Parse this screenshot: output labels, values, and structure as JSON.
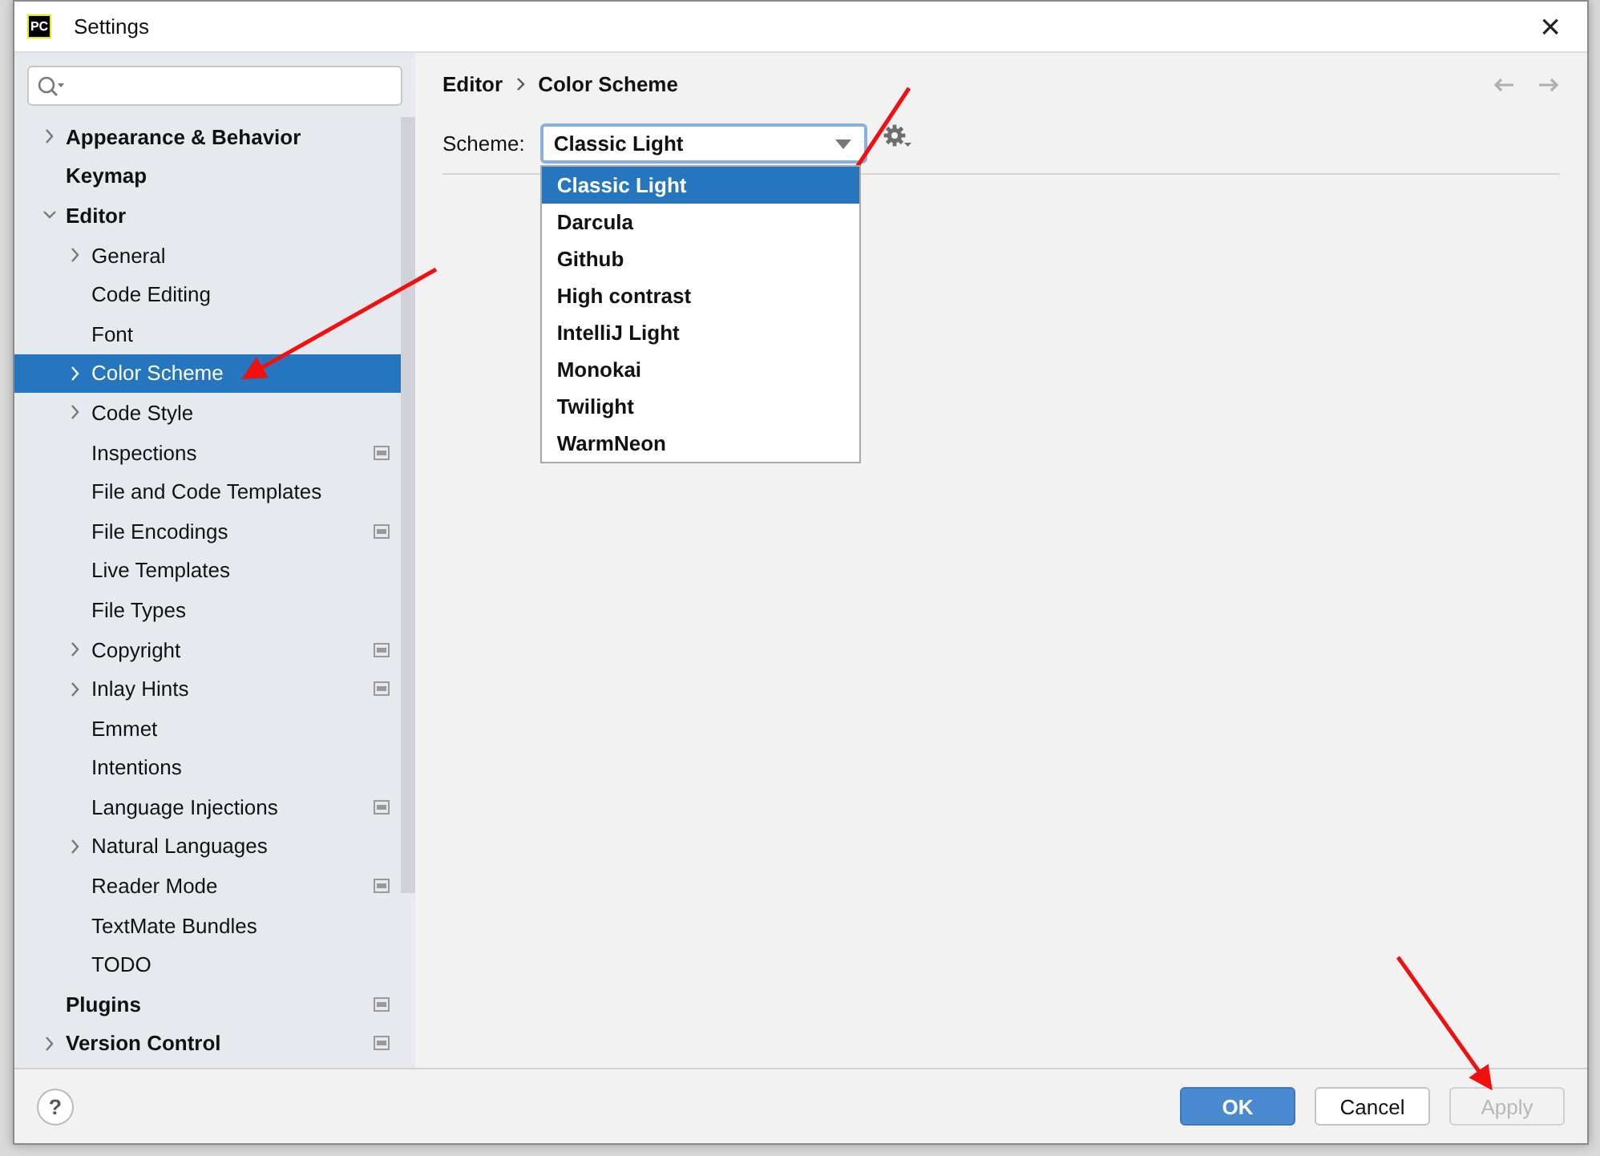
{
  "window": {
    "title": "Settings",
    "logo": "PC",
    "close": "×"
  },
  "sidebar": {
    "items": [
      {
        "label": "Appearance & Behavior",
        "expandable": true,
        "expanded": false,
        "selected": false
      },
      {
        "label": "Keymap",
        "selected": false
      },
      {
        "label": "Editor",
        "expandable": true,
        "expanded": true,
        "selected": false,
        "children": [
          {
            "label": "General",
            "expandable": true,
            "expanded": false,
            "selected": false
          },
          {
            "label": "Code Editing",
            "selected": false
          },
          {
            "label": "Font",
            "selected": false
          },
          {
            "label": "Color Scheme",
            "expandable": true,
            "expanded": false,
            "selected": true
          },
          {
            "label": "Code Style",
            "expandable": true,
            "expanded": false,
            "selected": false
          },
          {
            "label": "Inspections",
            "selected": false,
            "badge": true
          },
          {
            "label": "File and Code Templates",
            "selected": false
          },
          {
            "label": "File Encodings",
            "selected": false,
            "badge": true
          },
          {
            "label": "Live Templates",
            "selected": false
          },
          {
            "label": "File Types",
            "selected": false
          },
          {
            "label": "Copyright",
            "expandable": true,
            "expanded": false,
            "selected": false,
            "badge": true
          },
          {
            "label": "Inlay Hints",
            "expandable": true,
            "expanded": false,
            "selected": false,
            "badge": true
          },
          {
            "label": "Emmet",
            "selected": false
          },
          {
            "label": "Intentions",
            "selected": false
          },
          {
            "label": "Language Injections",
            "selected": false,
            "badge": true
          },
          {
            "label": "Natural Languages",
            "expandable": true,
            "expanded": false,
            "selected": false
          },
          {
            "label": "Reader Mode",
            "selected": false,
            "badge": true
          },
          {
            "label": "TextMate Bundles",
            "selected": false
          },
          {
            "label": "TODO",
            "selected": false
          }
        ]
      },
      {
        "label": "Plugins",
        "selected": false,
        "badge": true
      },
      {
        "label": "Version Control",
        "expandable": true,
        "expanded": false,
        "selected": false,
        "badge": true
      }
    ]
  },
  "breadcrumb": [
    "Editor",
    "Color Scheme"
  ],
  "scheme": {
    "label": "Scheme:",
    "value": "Classic Light",
    "options": [
      {
        "label": "Classic Light",
        "selected": true
      },
      {
        "label": "Darcula",
        "selected": false
      },
      {
        "label": "Github",
        "selected": false
      },
      {
        "label": "High contrast",
        "selected": false
      },
      {
        "label": "IntelliJ Light",
        "selected": false
      },
      {
        "label": "Monokai",
        "selected": false
      },
      {
        "label": "Twilight",
        "selected": false
      },
      {
        "label": "WarmNeon",
        "selected": false
      }
    ]
  },
  "footer": {
    "help": "?",
    "buttons": [
      {
        "label": "OK",
        "kind": "primary",
        "disabled": false
      },
      {
        "label": "Cancel",
        "kind": "normal",
        "disabled": false
      },
      {
        "label": "Apply",
        "kind": "normal",
        "disabled": true
      }
    ]
  }
}
